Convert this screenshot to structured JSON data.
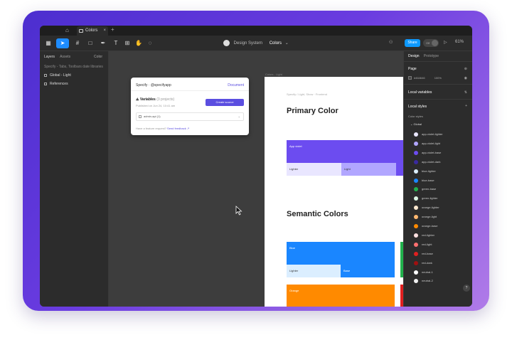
{
  "tabbar": {
    "tab_title": "Colors",
    "close_glyph": "×",
    "new_tab_glyph": "+"
  },
  "toolbar": {
    "team": "Design System",
    "file": "Colors",
    "share_label": "Share",
    "toggle_label": "Off",
    "zoom": "61%"
  },
  "left_panel": {
    "tabs": [
      "Layers",
      "Assets"
    ],
    "current": "Color",
    "items": [
      {
        "label": "Specify - Tabs, Toolbars date libraries",
        "muted": true
      },
      {
        "label": "Global - Light",
        "muted": false
      },
      {
        "label": "References",
        "muted": false
      }
    ]
  },
  "plugin": {
    "title": "Specify · @specifyapp",
    "doc_link": "Document",
    "variables_label": "Variables",
    "variables_count": "(3 projects)",
    "date": "Published on Jun 24, 10:41 am",
    "button_label": "Create source",
    "select_label": "admin-api (1)",
    "footer": "Have a feature request?",
    "footer_link": "Send feedback ↗"
  },
  "canvas": {
    "frame_label": "Colors - Light",
    "crumb": "Specify  /  Light, Show · Frontend",
    "primary_title": "Primary Color",
    "semantic_title": "Semantic Colors",
    "swatches": {
      "app_violet": "App violet",
      "lighter": "Lighter",
      "light": "Light",
      "blue": "Blue",
      "blue_lighter": "Lighter",
      "blue_base": "Base",
      "orange": "Orange"
    }
  },
  "right_panel": {
    "tabs": [
      "Design",
      "Prototype"
    ],
    "page_label": "Page",
    "page_hex": "#464646",
    "page_opacity": "100%",
    "local_variables": "Local variables",
    "local_styles": "Local styles",
    "color_styles": "Color styles",
    "group": "Global",
    "styles": [
      {
        "name": "app-violet-lighter",
        "color": "#e9e6ff"
      },
      {
        "name": "app-violet-light",
        "color": "#b1a6ff"
      },
      {
        "name": "app-violet-base",
        "color": "#6c4cf0"
      },
      {
        "name": "app-violet-dark",
        "color": "#3a2aa0"
      },
      {
        "name": "blue-lighter",
        "color": "#dbeeff"
      },
      {
        "name": "blue-base",
        "color": "#1a86ff"
      },
      {
        "name": "green-base",
        "color": "#22b14c"
      },
      {
        "name": "green-lighter",
        "color": "#dcf5e3"
      },
      {
        "name": "orange-lighter",
        "color": "#ffe9d0"
      },
      {
        "name": "orange-light",
        "color": "#ffb870"
      },
      {
        "name": "orange-base",
        "color": "#ff8a00"
      },
      {
        "name": "red-lighter",
        "color": "#ffe0e0"
      },
      {
        "name": "red-light",
        "color": "#ff7070"
      },
      {
        "name": "red-base",
        "color": "#e02020"
      },
      {
        "name": "red-dark",
        "color": "#a01010"
      },
      {
        "name": "neutral-1",
        "color": "#ffffff"
      },
      {
        "name": "neutral-2",
        "color": "#f2f2f2"
      }
    ],
    "help": "?"
  },
  "colors": {
    "violet": "#6c4cf0",
    "violet_lighter": "#e9e6ff",
    "violet_light": "#b1a6ff",
    "blue": "#1a86ff",
    "blue_lighter": "#dbeeff",
    "green": "#22b14c",
    "orange": "#ff8a00"
  }
}
